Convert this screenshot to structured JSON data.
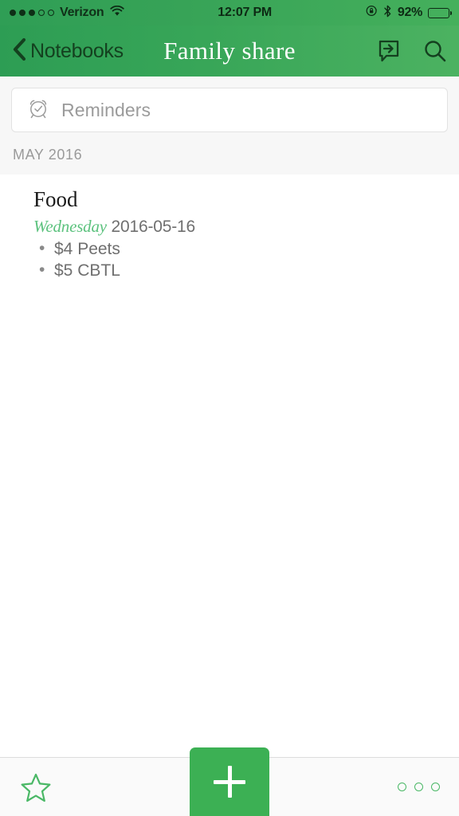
{
  "status_bar": {
    "signal_dots_filled": 3,
    "signal_dots_total": 5,
    "carrier": "Verizon",
    "wifi_icon": "wifi-icon",
    "time": "12:07 PM",
    "rotation_lock_icon": "rotation-lock-icon",
    "bluetooth_icon": "bluetooth-icon",
    "battery_percent": "92%",
    "battery_level": 92
  },
  "nav_bar": {
    "back_label": "Notebooks",
    "back_icon": "chevron-left-icon",
    "title": "Family share",
    "share_icon": "share-chat-icon",
    "search_icon": "search-icon"
  },
  "reminders": {
    "label": "Reminders",
    "icon": "alarm-clock-check-icon"
  },
  "section": {
    "header": "MAY 2016"
  },
  "notes": [
    {
      "title": "Food",
      "day": "Wednesday",
      "date": "2016-05-16",
      "bullets": [
        "$4 Peets",
        "$5 CBTL"
      ]
    }
  ],
  "toolbar": {
    "star_icon": "star-outline-icon",
    "add_icon": "plus-icon",
    "more_icon": "more-options-icon"
  },
  "colors": {
    "brand_green": "#3cb054",
    "header_green_left": "#2d9d54",
    "header_green_right": "#4cb261",
    "accent_day_green": "#5cc27e",
    "nav_dark_green": "#14401f"
  }
}
